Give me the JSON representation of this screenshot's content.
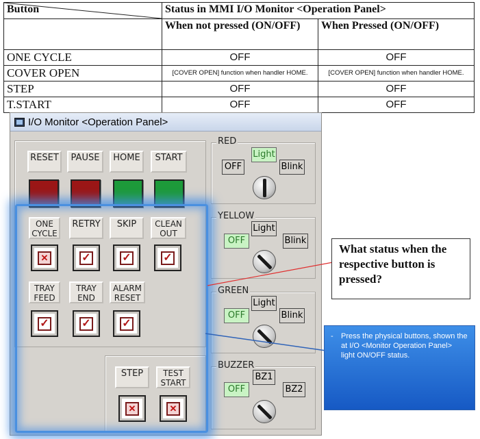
{
  "table": {
    "header_button": "Button",
    "header_status": "Status in MMI I/O Monitor <Operation Panel>",
    "sub_not_pressed": "When not pressed (ON/OFF)",
    "sub_pressed": "When Pressed (ON/OFF)",
    "rows": [
      {
        "button": "ONE CYCLE",
        "not_pressed": "OFF",
        "pressed": "OFF"
      },
      {
        "button": "COVER OPEN",
        "not_pressed": "[COVER OPEN] function when handler HOME.",
        "pressed": "[COVER OPEN] function when handler HOME."
      },
      {
        "button": "STEP",
        "not_pressed": "OFF",
        "pressed": "OFF"
      },
      {
        "button": "T.START",
        "not_pressed": "OFF",
        "pressed": "OFF"
      }
    ]
  },
  "window": {
    "title": "I/O Monitor <Operation Panel>",
    "top_buttons": [
      {
        "label": "RESET",
        "lamp": "red"
      },
      {
        "label": "PAUSE",
        "lamp": "red"
      },
      {
        "label": "HOME",
        "lamp": "green"
      },
      {
        "label": "START",
        "lamp": "green"
      }
    ],
    "row2": [
      {
        "label": "ONE CYCLE",
        "checked": false
      },
      {
        "label": "RETRY",
        "checked": true
      },
      {
        "label": "SKIP",
        "checked": true
      },
      {
        "label": "CLEAN OUT",
        "checked": true
      }
    ],
    "row3": [
      {
        "label": "TRAY FEED",
        "checked": true
      },
      {
        "label": "TRAY END",
        "checked": true
      },
      {
        "label": "ALARM RESET",
        "checked": true
      }
    ],
    "bottom": [
      {
        "label": "STEP",
        "checked": false
      },
      {
        "label": "TEST START",
        "checked": false
      }
    ],
    "lights": [
      {
        "name": "RED",
        "off": "OFF",
        "light": "Light",
        "blink": "Blink",
        "active": "light"
      },
      {
        "name": "YELLOW",
        "off": "OFF",
        "light": "Light",
        "blink": "Blink",
        "active": "off"
      },
      {
        "name": "GREEN",
        "off": "OFF",
        "light": "Light",
        "blink": "Blink",
        "active": "off"
      },
      {
        "name": "BUZZER",
        "off": "OFF",
        "light": "BZ1",
        "blink": "BZ2",
        "active": "off"
      }
    ]
  },
  "callouts": {
    "question": "What status when the respective button is pressed?",
    "note_dash": "-",
    "note": "Press the physical buttons, shown the at I/O <Monitor Operation Panel> light ON/OFF status."
  },
  "colors": {
    "lamp_red": "#9b1616",
    "lamp_green": "#1d9a3a",
    "highlight_blue": "#4a90e0",
    "note_blue": "#2a74d8",
    "option_active": "#c9f3c4"
  }
}
